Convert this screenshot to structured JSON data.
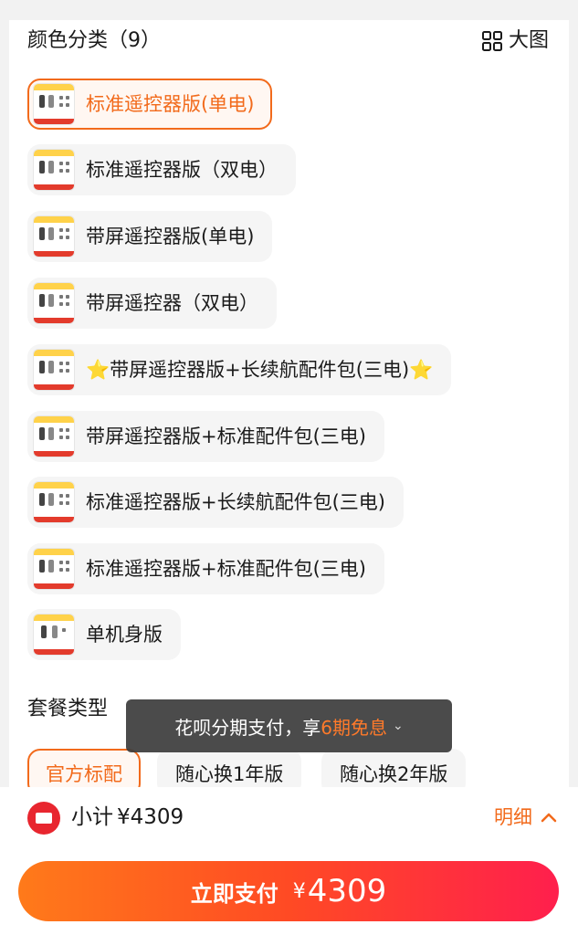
{
  "color_section": {
    "title": "颜色分类（9）",
    "big_view_label": "大图",
    "options": [
      {
        "label": "标准遥控器版(单电)",
        "selected": true
      },
      {
        "label": "标准遥控器版（双电）",
        "selected": false
      },
      {
        "label": "带屏遥控器版(单电)",
        "selected": false
      },
      {
        "label": "带屏遥控器（双电）",
        "selected": false
      },
      {
        "label": "带屏遥控器版+长续航配件包(三电)",
        "star_left": "⭐",
        "star_right": "⭐",
        "selected": false
      },
      {
        "label": "带屏遥控器版+标准配件包(三电)",
        "selected": false
      },
      {
        "label": "标准遥控器版+长续航配件包(三电)",
        "selected": false
      },
      {
        "label": "标准遥控器版+标准配件包(三电)",
        "selected": false
      },
      {
        "label": "单机身版",
        "selected": false
      }
    ]
  },
  "package_section": {
    "title": "套餐类型",
    "options": [
      {
        "label": "官方标配",
        "selected": true
      },
      {
        "label": "随心换1年版",
        "selected": false
      },
      {
        "label": "随心换2年版",
        "selected": false
      }
    ]
  },
  "toast": {
    "prefix": "花呗分期支付，享",
    "highlight": "6期免息",
    "chevron": "⌄"
  },
  "footer": {
    "subtotal_label": "小计",
    "subtotal_amount": "¥4309",
    "detail_label": "明细",
    "pay_label": "立即支付",
    "pay_currency": "¥",
    "pay_amount": "4309"
  },
  "colors": {
    "accent": "#f26a1b",
    "coupon_red": "#e8262f",
    "button_gradient": [
      "#ff7a1a",
      "#ff1f4d"
    ]
  }
}
